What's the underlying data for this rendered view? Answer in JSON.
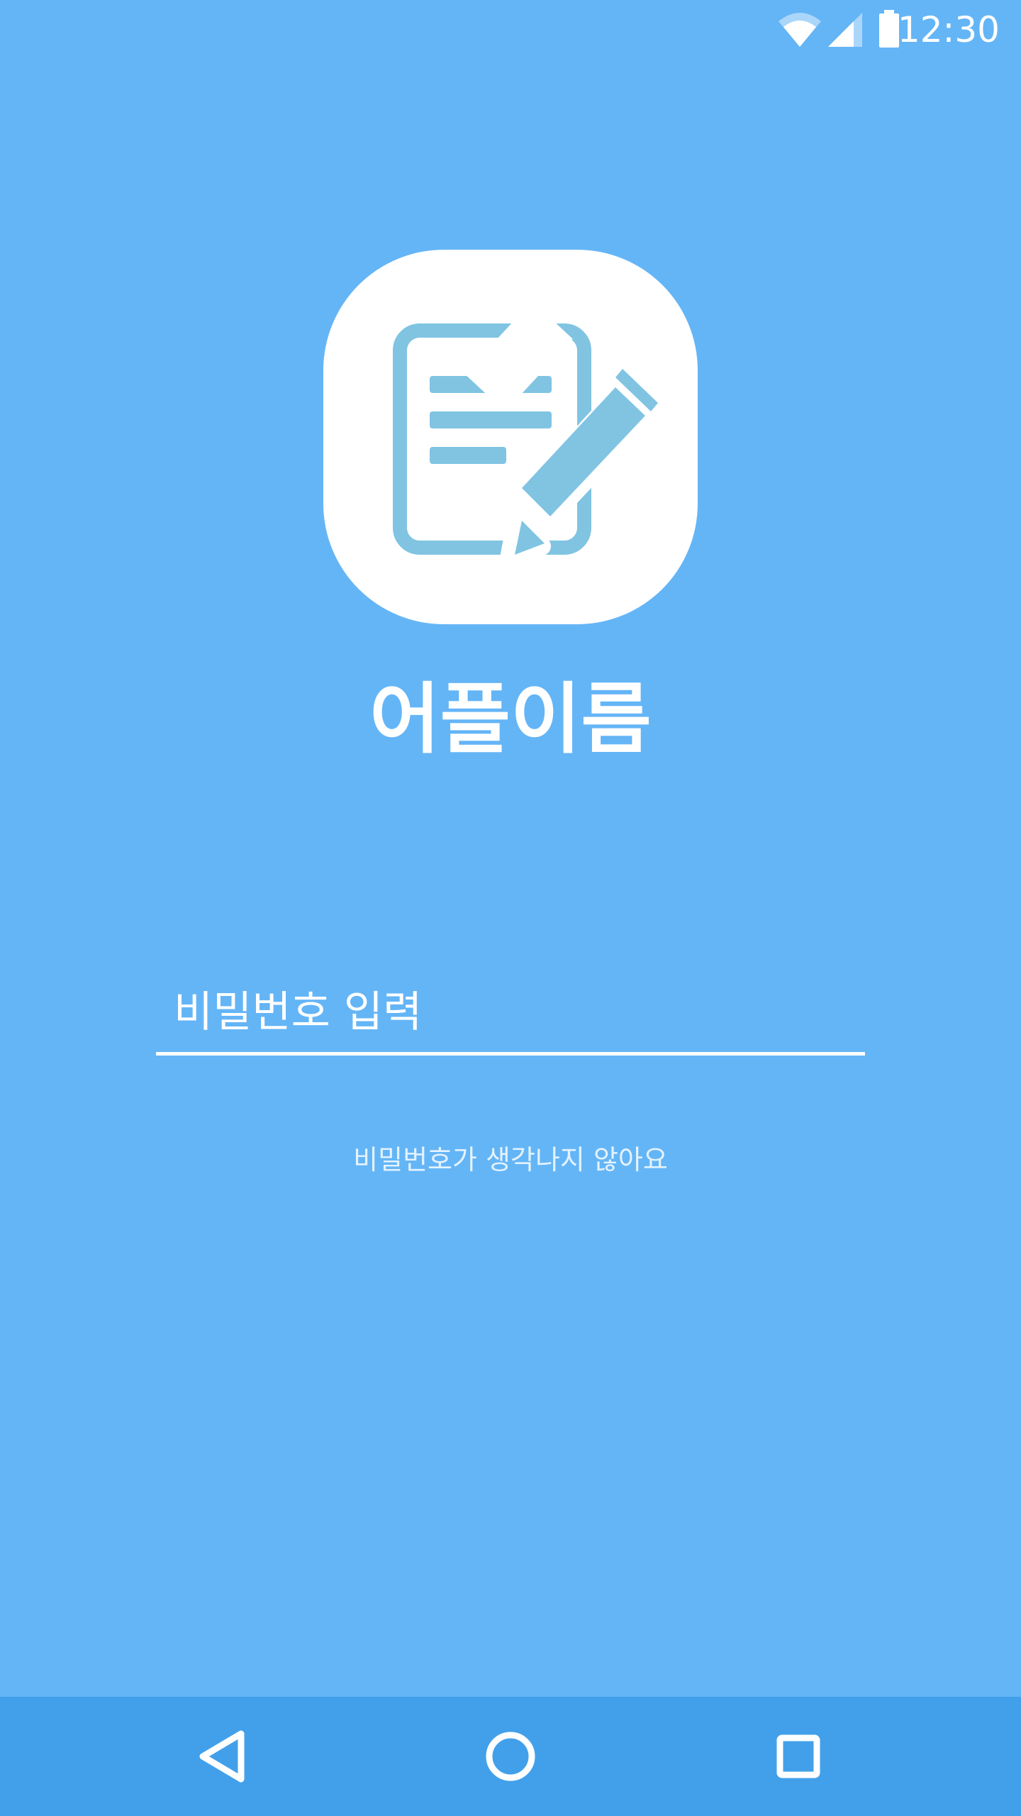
{
  "status_bar": {
    "time": "12:30",
    "icons": [
      "wifi-icon",
      "cell-signal-icon",
      "battery-icon"
    ]
  },
  "app": {
    "icon": "note-edit-icon",
    "name": "어플이름"
  },
  "login": {
    "password_placeholder": "비밀번호 입력",
    "password_value": "",
    "forgot_password_label": "비밀번호가 생각나지 않아요"
  },
  "nav_bar": {
    "buttons": [
      "back-icon",
      "home-icon",
      "recents-icon"
    ]
  },
  "colors": {
    "background": "#64B5F6",
    "nav_bar": "#42A0EA",
    "icon_accent": "#80C4E2",
    "text": "#FFFFFF"
  }
}
